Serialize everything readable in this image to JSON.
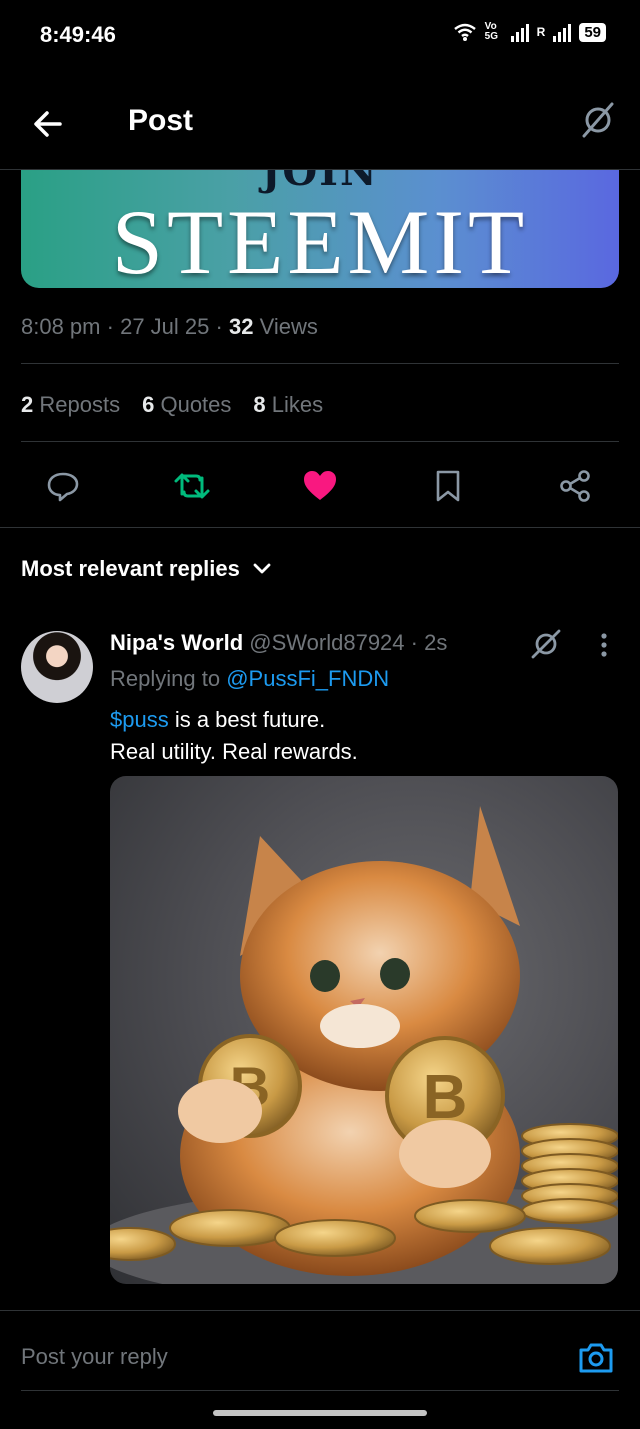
{
  "status_bar": {
    "time": "8:49:46",
    "network_label": "Vo 5G",
    "roaming_label": "R",
    "battery": "59"
  },
  "header": {
    "title": "Post"
  },
  "banner": {
    "join_text": "JOIN",
    "main_text": "STEEMIT"
  },
  "post_meta": {
    "time": "8:08 pm",
    "date": "27 Jul 25",
    "views_count": "32",
    "views_label": "Views",
    "separator": "·"
  },
  "stats": [
    {
      "count": "2",
      "label": "Reposts"
    },
    {
      "count": "6",
      "label": "Quotes"
    },
    {
      "count": "8",
      "label": "Likes"
    }
  ],
  "actions": [
    {
      "name": "reply",
      "icon": "comment-icon"
    },
    {
      "name": "repost",
      "icon": "repost-icon",
      "color": "#00ba7c"
    },
    {
      "name": "like",
      "icon": "heart-icon",
      "color": "#f91880"
    },
    {
      "name": "bookmark",
      "icon": "bookmark-icon"
    },
    {
      "name": "share",
      "icon": "share-icon"
    }
  ],
  "sort": {
    "label": "Most relevant replies"
  },
  "reply": {
    "name": "Nipa's World",
    "handle": "@SWorld87924",
    "time": "2s",
    "replying_to_label": "Replying to",
    "replying_to_handle": "@PussFi_FNDN",
    "cashtag": "$puss",
    "text_line1_rest": " is a best future.",
    "text_line2": "Real utility. Real rewards."
  },
  "compose": {
    "placeholder": "Post your reply"
  },
  "colors": {
    "accent": "#1d9bf0",
    "like": "#f91880",
    "repost": "#00ba7c",
    "muted": "#71767b",
    "background": "#000000"
  }
}
